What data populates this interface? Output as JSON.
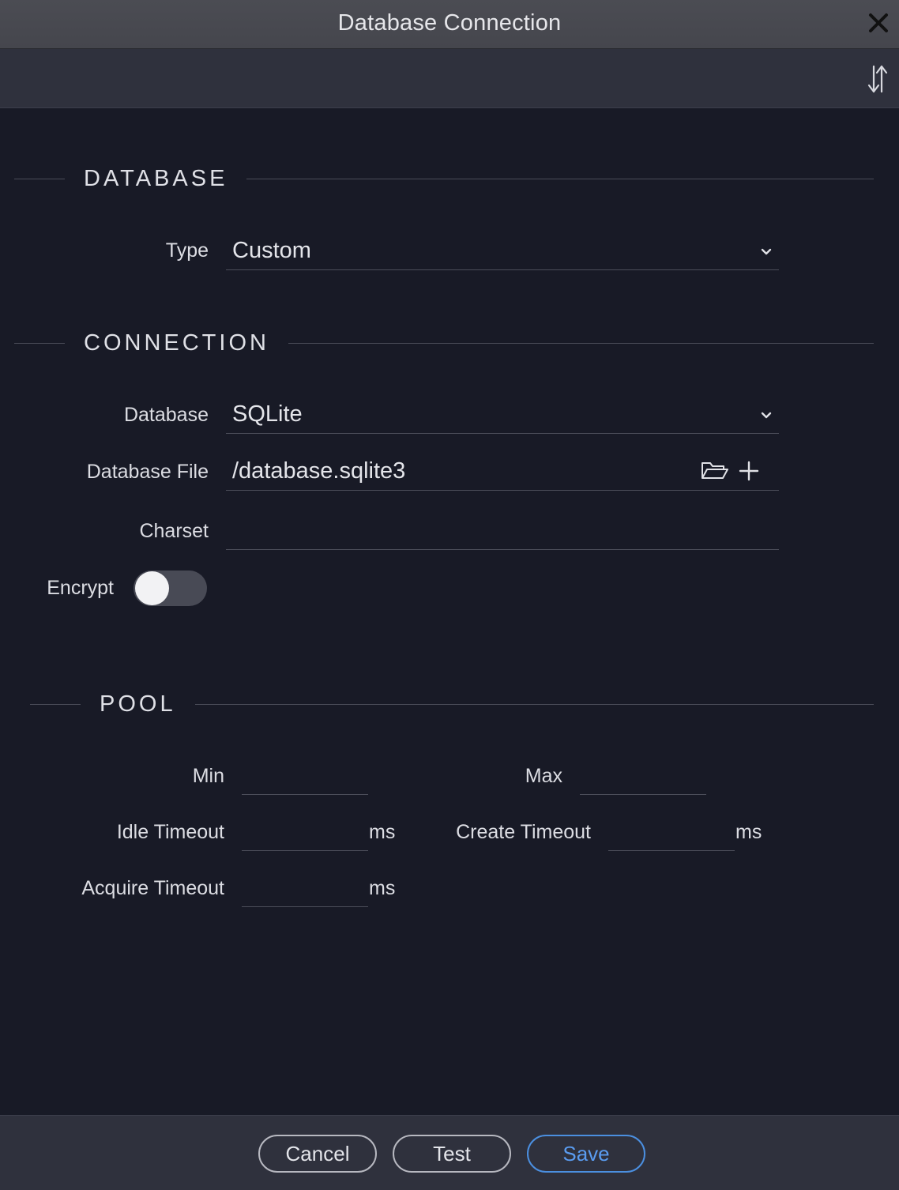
{
  "window": {
    "title": "Database Connection"
  },
  "sections": {
    "database": "DATABASE",
    "connection": "CONNECTION",
    "pool": "POOL"
  },
  "database_section": {
    "type_label": "Type",
    "type_value": "Custom"
  },
  "connection_section": {
    "database_label": "Database",
    "database_value": "SQLite",
    "file_label": "Database File",
    "file_value": "/database.sqlite3",
    "charset_label": "Charset",
    "charset_value": "",
    "encrypt_label": "Encrypt",
    "encrypt_on": false
  },
  "pool_section": {
    "min_label": "Min",
    "max_label": "Max",
    "idle_label": "Idle Timeout",
    "create_label": "Create Timeout",
    "acquire_label": "Acquire Timeout",
    "unit": "ms"
  },
  "footer": {
    "cancel": "Cancel",
    "test": "Test",
    "save": "Save"
  },
  "colors": {
    "background": "#181a26",
    "accent": "#4b8fe0"
  },
  "icons": [
    "close-icon",
    "sort-icon",
    "chevron-down-icon",
    "folder-open-icon",
    "plus-icon"
  ]
}
